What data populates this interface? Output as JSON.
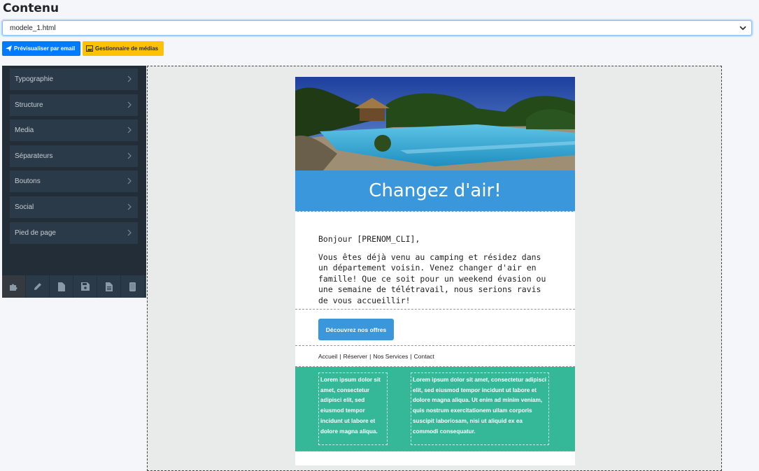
{
  "page_title": "Contenu",
  "template_select": {
    "value": "modele_1.html"
  },
  "actions": {
    "preview_email": "Prévisualiser par email",
    "media_manager": "Gestionnaire de médias"
  },
  "sidebar": {
    "items": [
      {
        "label": "Typographie"
      },
      {
        "label": "Structure"
      },
      {
        "label": "Media"
      },
      {
        "label": "Séparateurs"
      },
      {
        "label": "Boutons"
      },
      {
        "label": "Social"
      },
      {
        "label": "Pied de page"
      }
    ],
    "tools": [
      "puzzle-icon",
      "pencil-icon",
      "file-icon",
      "save-icon",
      "file-text-icon",
      "mobile-icon"
    ]
  },
  "email": {
    "banner_title": "Changez d'air!",
    "greeting": "Bonjour [PRENOM_CLI],",
    "body": "Vous êtes déjà venu au camping et résidez dans un département voisin. Venez changer d'air en famille! Que ce soit pour un weekend évasion ou une semaine de télétravail, nous serions ravis de vous accueillir!",
    "cta_label": "Découvrez nos offres",
    "links": [
      "Accueil",
      "Réserver",
      "Nos Services",
      "Contact"
    ],
    "col1_text": "Lorem ipsum dolor sit amet, consectetur adipisci elit, sed eiusmod tempor incidunt ut labore et dolore magna aliqua.",
    "col2_text": "Lorem ipsum dolor sit amet, consectetur adipisci elit, sed eiusmod tempor incidunt ut labore et dolore magna aliqua. Ut enim ad minim veniam, quis nostrum exercitationem ullam corporis suscipit laboriosam, nisi ut aliquid ex ea commodi consequatur."
  },
  "colors": {
    "primary": "#007bff",
    "warning": "#ffc107",
    "banner": "#3a97db",
    "teal": "#35b898",
    "sidebar_bg": "#222d37"
  }
}
